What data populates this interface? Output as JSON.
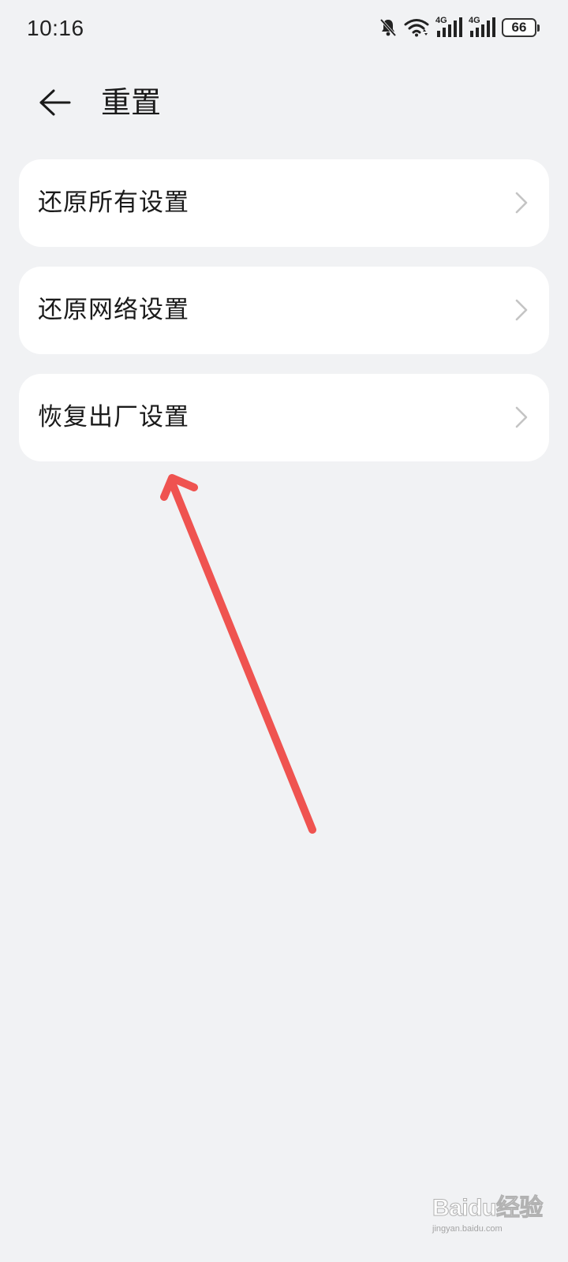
{
  "status_bar": {
    "time": "10:16",
    "battery_level": "66",
    "signal_1_label": "4G",
    "signal_2_label": "4G",
    "icons": [
      "bell-muted-icon",
      "wifi-icon",
      "signal-4g-icon",
      "signal-4g-icon",
      "battery-icon"
    ]
  },
  "header": {
    "back_icon": "arrow-left-icon",
    "title": "重置"
  },
  "settings_items": [
    {
      "label": "还原所有设置",
      "icon": "chevron-right-icon"
    },
    {
      "label": "还原网络设置",
      "icon": "chevron-right-icon"
    },
    {
      "label": "恢复出厂设置",
      "icon": "chevron-right-icon"
    }
  ],
  "annotation": {
    "color": "#ef5350",
    "points_to": "恢复出厂设置"
  },
  "watermark": {
    "logo_text": "Baidu经验",
    "url": "jingyan.baidu.com"
  },
  "colors": {
    "background": "#f1f2f4",
    "card": "#ffffff",
    "text": "#1a1a1a",
    "chevron": "#c4c4c4"
  }
}
